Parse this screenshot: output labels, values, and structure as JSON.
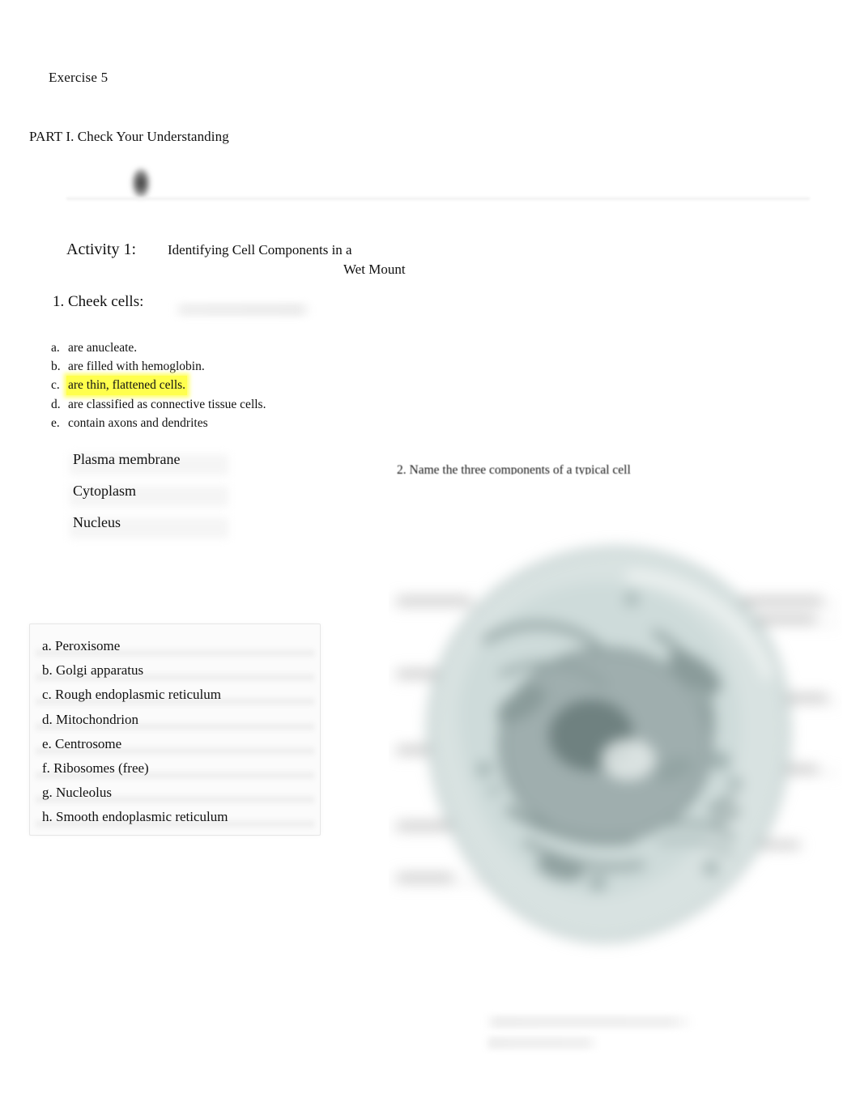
{
  "document": {
    "exercise_title": "Exercise 5",
    "part_heading": "PART I. Check Your Understanding"
  },
  "activity": {
    "label": "Activity 1:",
    "title_line_1": "Identifying Cell Components in a",
    "title_line_2": "Wet Mount"
  },
  "question_1": {
    "stem": "1. Cheek cells:",
    "options": [
      {
        "letter": "a.",
        "text": "are anucleate.",
        "highlighted": false
      },
      {
        "letter": "b.",
        "text": "are filled with hemoglobin.",
        "highlighted": false
      },
      {
        "letter": "c.",
        "text": "are thin, flattened cells.",
        "highlighted": true
      },
      {
        "letter": "d.",
        "text": "are classified as connective tissue cells.",
        "highlighted": false
      },
      {
        "letter": "e.",
        "text": "contain axons and dendrites",
        "highlighted": false
      }
    ],
    "highlight_color": "#ffff4d"
  },
  "question_2": {
    "stem": "2. Name the three components of a typical cell",
    "answers": [
      "Plasma membrane",
      "Cytoplasm",
      "Nucleus"
    ]
  },
  "organelle_box": {
    "items": [
      "a. Peroxisome",
      "b. Golgi apparatus",
      "c. Rough endoplasmic reticulum",
      "d. Mitochondrion",
      "e. Centrosome",
      "f. Ribosomes (free)",
      "g. Nucleolus",
      "h. Smooth endoplasmic reticulum"
    ]
  },
  "figure": {
    "description": "Blurred grayscale-teal illustration of an animal cell with label leader lines",
    "accent_color": "#aebdbd"
  }
}
